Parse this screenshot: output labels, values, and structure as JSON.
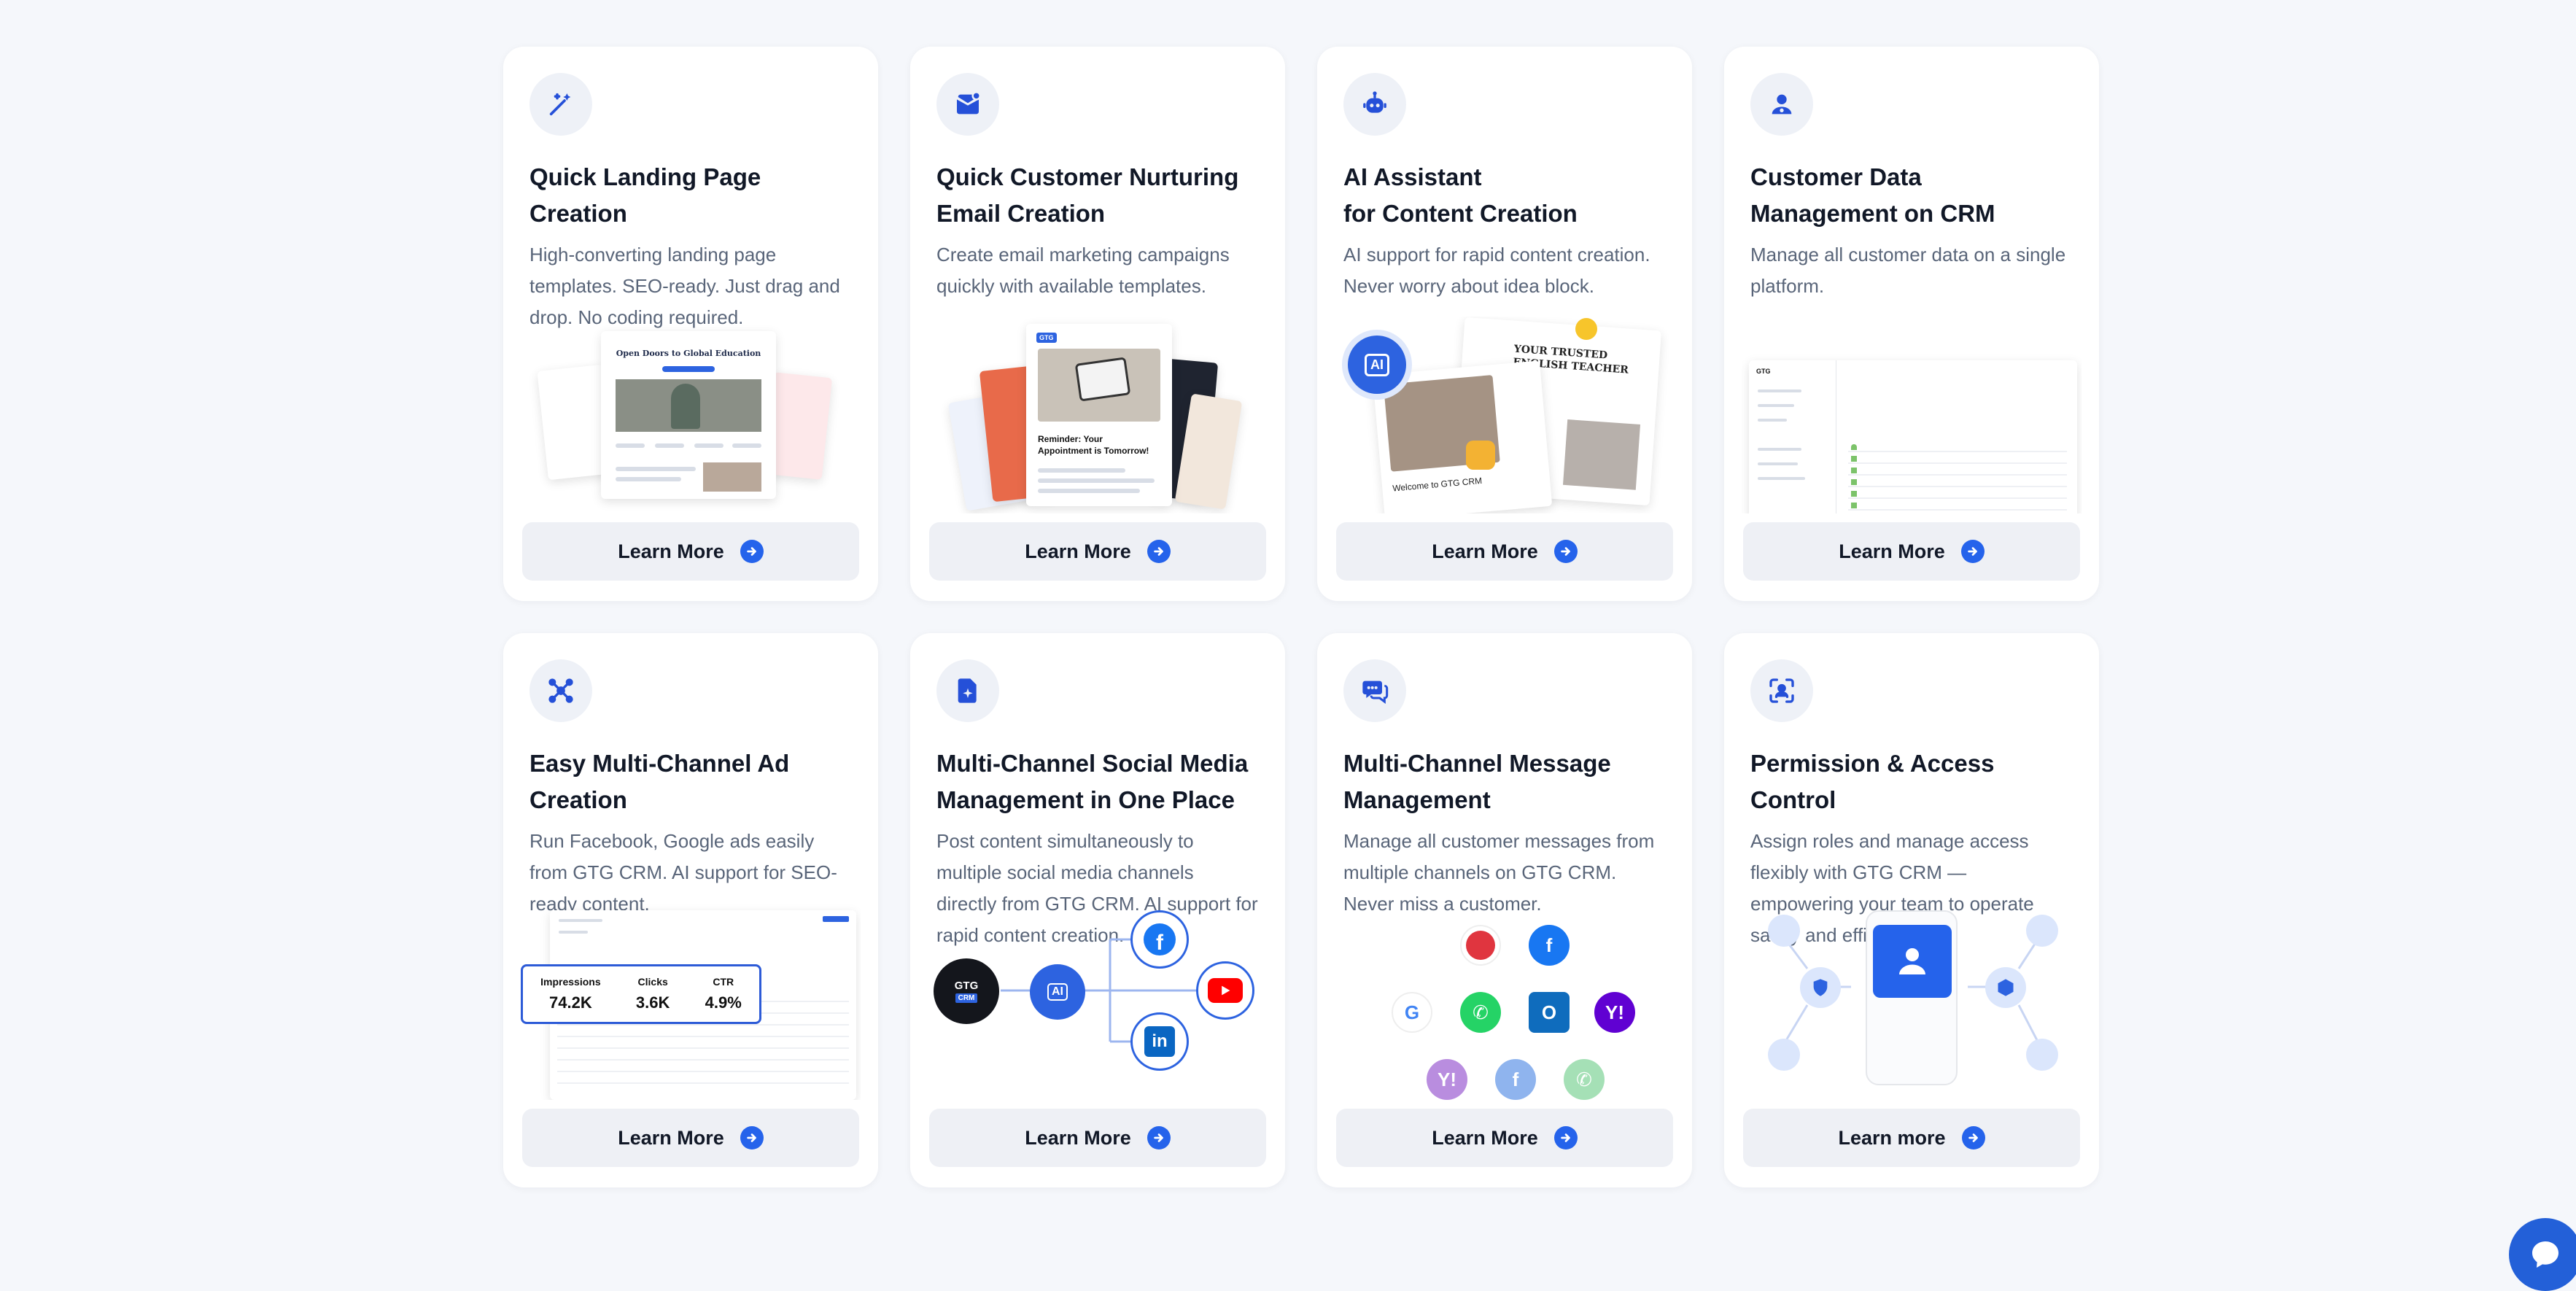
{
  "cards": [
    {
      "title": "Quick Landing Page\nCreation",
      "desc": "High-converting landing page templates. SEO-ready. Just drag and drop. No coding required.",
      "button": "Learn More",
      "icon": "magic-wand-icon",
      "illustration": {
        "headline": "Open Doors to Global Education"
      }
    },
    {
      "title": "Quick Customer Nurturing\nEmail Creation",
      "desc": "Create email marketing campaigns quickly with available templates.",
      "button": "Learn More",
      "icon": "mail-icon",
      "illustration": {
        "headline": "Reminder: Your Appointment is Tomorrow!",
        "badge": "GTG"
      }
    },
    {
      "title": "AI Assistant\nfor Content Creation",
      "desc": "AI support for rapid content creation. Never worry about idea block.",
      "button": "Learn More",
      "icon": "robot-icon",
      "illustration": {
        "headline": "YOUR TRUSTED ENGLISH TEACHER",
        "welcome": "Welcome to GTG CRM",
        "ai_label": "AI"
      }
    },
    {
      "title": "Customer Data\nManagement on CRM",
      "desc": "Manage all customer data on a single platform.",
      "button": "Learn More",
      "icon": "user-icon",
      "illustration": {
        "brand": "GTG"
      }
    },
    {
      "title": "Easy Multi-Channel Ad\nCreation",
      "desc": "Run Facebook, Google ads easily from GTG CRM. AI support for SEO-ready content.",
      "button": "Learn More",
      "icon": "network-icon",
      "illustration": {
        "stats": [
          {
            "label": "Impressions",
            "value": "74.2K"
          },
          {
            "label": "Clicks",
            "value": "3.6K"
          },
          {
            "label": "CTR",
            "value": "4.9%"
          }
        ]
      }
    },
    {
      "title": "Multi-Channel Social Media\nManagement in One Place",
      "desc": "Post content simultaneously to multiple social media channels directly from GTG CRM. AI support for rapid content creation.",
      "button": "Learn More",
      "icon": "document-spark-icon",
      "illustration": {
        "brand_top": "GTG",
        "brand_bottom": "CRM",
        "ai_label": "AI"
      }
    },
    {
      "title": "Multi-Channel Message\nManagement",
      "desc": "Manage all customer messages from multiple channels on GTG CRM. Never miss a customer.",
      "button": "Learn More",
      "icon": "chat-icon",
      "illustration": {}
    },
    {
      "title": "Permission & Access\nControl",
      "desc": "Assign roles and manage access flexibly with GTG CRM — empowering your team to operate safely and efficiently.",
      "button": "Learn more",
      "icon": "user-scan-icon",
      "illustration": {}
    }
  ],
  "colors": {
    "accent": "#2563eb",
    "card_bg": "#ffffff",
    "page_bg": "#f5f7fb",
    "button_bg": "#eef0f5"
  }
}
